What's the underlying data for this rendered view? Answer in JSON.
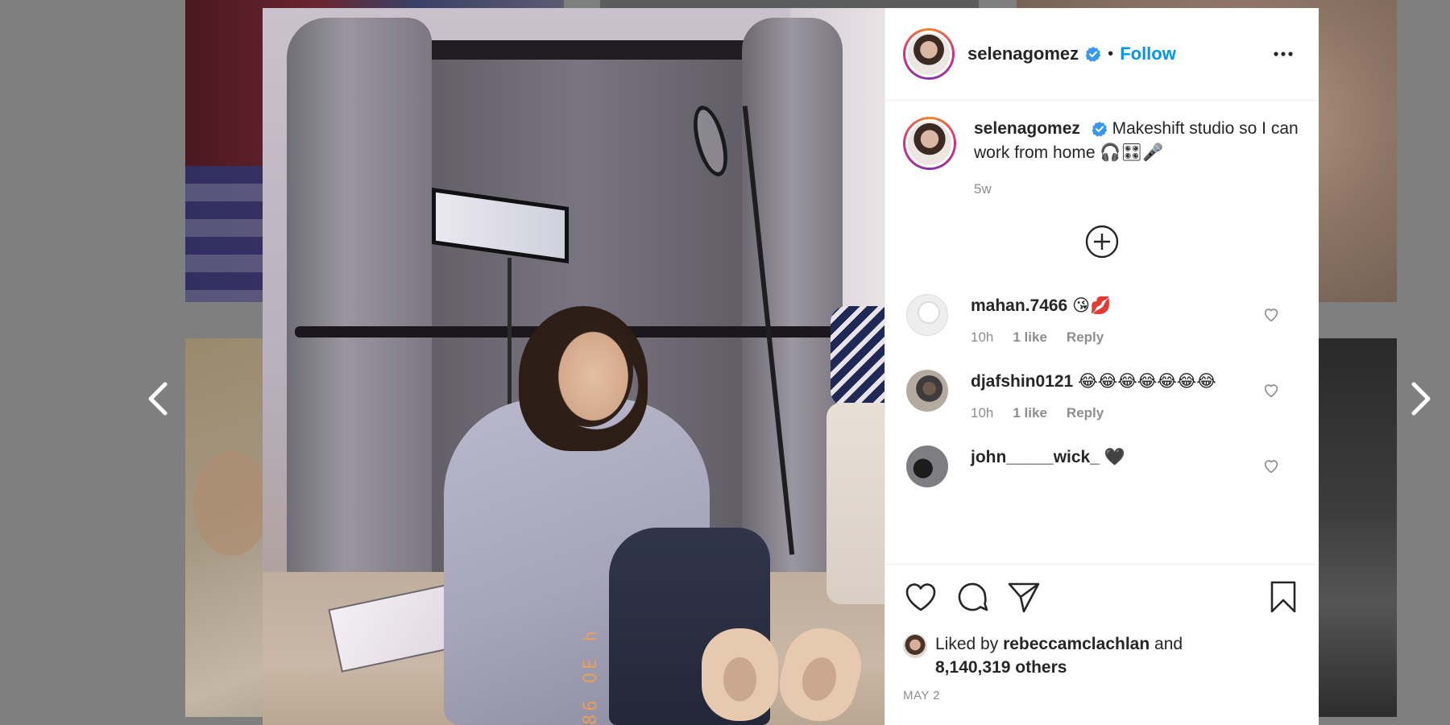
{
  "post": {
    "username": "selenagomez",
    "separator": "•",
    "follow_label": "Follow",
    "more_icon": "more-horizontal-icon",
    "caption": {
      "username": "selenagomez",
      "text": "Makeshift studio so I can work from home 🎧🎛🎤",
      "age": "5w"
    },
    "photo_stamp": "86 OE h"
  },
  "load_more_icon": "plus-circle-icon",
  "comments": [
    {
      "username": "mahan.7466",
      "text": "😘💋",
      "time": "10h",
      "likes": "1 like",
      "reply": "Reply"
    },
    {
      "username": "djafshin0121",
      "text": "😂😂😂😂😂😂😂",
      "time": "10h",
      "likes": "1 like",
      "reply": "Reply"
    },
    {
      "username": "john_____wick_",
      "text": "🖤",
      "time": "",
      "likes": "",
      "reply": ""
    }
  ],
  "likes": {
    "prefix": "Liked by",
    "user": "rebeccamclachlan",
    "joiner": "and",
    "others": "8,140,319 others"
  },
  "date": "MAY 2",
  "colors": {
    "accent": "#0095f6",
    "verified": "#3897f0",
    "text": "#262626",
    "muted": "#8e8e8e",
    "backdrop": "#7f7f7f"
  }
}
